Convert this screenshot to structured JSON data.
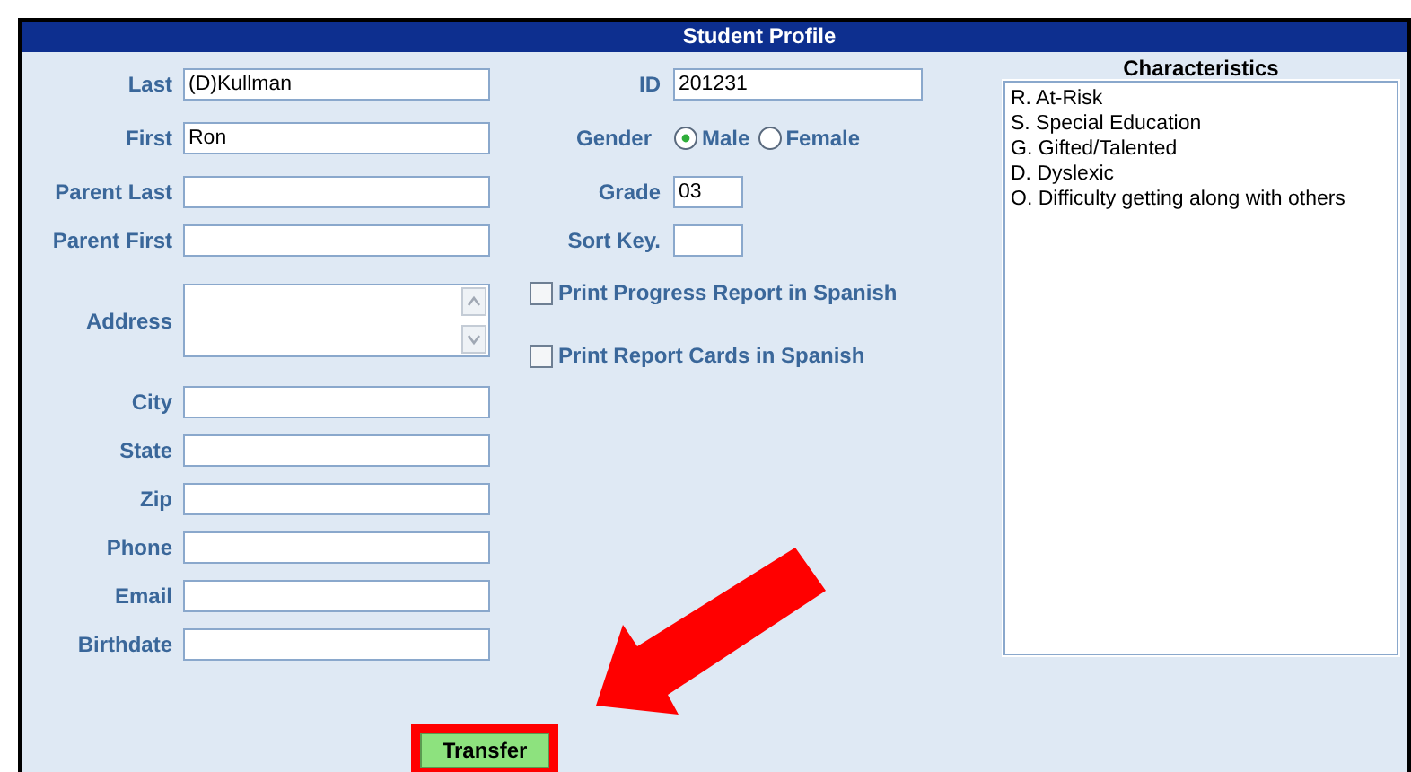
{
  "window": {
    "title": "Student Profile"
  },
  "fields": [
    {
      "label": "Last",
      "kind": "text",
      "value": "(D)Kullman"
    },
    {
      "label": "First",
      "kind": "text",
      "value": "Ron"
    },
    {
      "label": "Parent Last",
      "kind": "text"
    },
    {
      "label": "Parent First",
      "kind": "text"
    },
    {
      "label": "Address",
      "kind": "textarea"
    },
    {
      "label": "City",
      "kind": "text"
    },
    {
      "label": "State",
      "kind": "text"
    },
    {
      "label": "Zip",
      "kind": "text"
    },
    {
      "label": "Phone",
      "kind": "text"
    },
    {
      "label": "Email",
      "kind": "text"
    },
    {
      "label": "Birthdate",
      "kind": "text"
    }
  ],
  "id_field": {
    "label": "ID",
    "value": "201231"
  },
  "gender": {
    "label": "Gender",
    "options": [
      {
        "label": "Male",
        "selected": true
      },
      {
        "label": "Female",
        "selected": false
      }
    ]
  },
  "grade": {
    "label": "Grade",
    "value": "03"
  },
  "sort_key": {
    "label": "Sort Key."
  },
  "options": [
    {
      "label": "Print Progress Report in Spanish",
      "checked": false
    },
    {
      "label": "Print Report Cards in Spanish",
      "checked": false
    }
  ],
  "characteristics": {
    "title": "Characteristics",
    "items": [
      "R. At-Risk",
      "S. Special Education",
      "G. Gifted/Talented",
      "D. Dyslexic",
      "O. Difficulty getting along with others"
    ]
  },
  "transfer_button": {
    "label": "Transfer"
  }
}
